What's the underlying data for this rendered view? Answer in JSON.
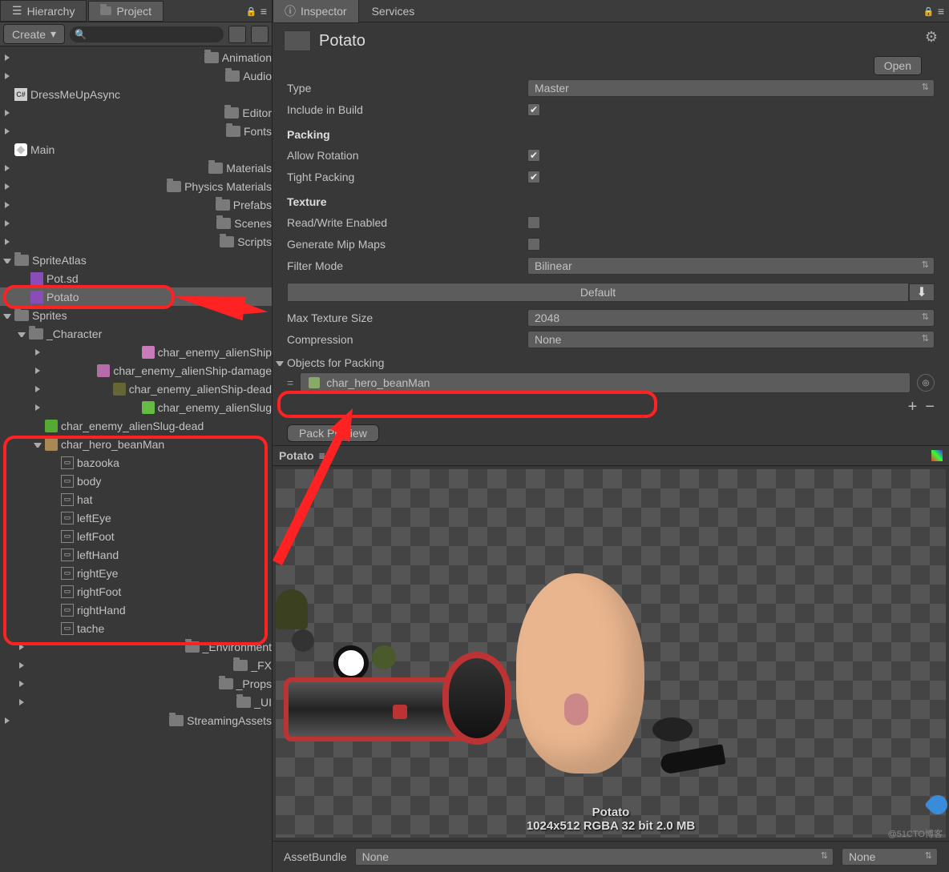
{
  "left": {
    "tabs": {
      "hierarchy": "Hierarchy",
      "project": "Project"
    },
    "create": "Create",
    "tree": {
      "animation": "Animation",
      "audio": "Audio",
      "dress": "DressMeUpAsync",
      "editor": "Editor",
      "fonts": "Fonts",
      "main": "Main",
      "materials": "Materials",
      "physmat": "Physics Materials",
      "prefabs": "Prefabs",
      "scenes": "Scenes",
      "scripts": "Scripts",
      "spriteatlas": "SpriteAtlas",
      "potsd": "Pot.sd",
      "potato": "Potato",
      "sprites": "Sprites",
      "character": "_Character",
      "alienship": "char_enemy_alienShip",
      "alienshipd": "char_enemy_alienShip-damage",
      "alienshipdead": "char_enemy_alienShip-dead",
      "alienslug": "char_enemy_alienSlug",
      "alienslugdead": "char_enemy_alienSlug-dead",
      "beanman": "char_hero_beanMan",
      "bazooka": "bazooka",
      "body": "body",
      "hat": "hat",
      "lefteye": "leftEye",
      "leftfoot": "leftFoot",
      "lefthand": "leftHand",
      "righteye": "rightEye",
      "rightfoot": "rightFoot",
      "righthand": "rightHand",
      "tache": "tache",
      "env": "_Environment",
      "fx": "_FX",
      "props": "_Props",
      "ui": "_UI",
      "streaming": "StreamingAssets"
    }
  },
  "right": {
    "tabs": {
      "inspector": "Inspector",
      "services": "Services"
    },
    "title": "Potato",
    "open": "Open",
    "type": "Type",
    "type_v": "Master",
    "include": "Include in Build",
    "packing": "Packing",
    "allowrot": "Allow Rotation",
    "tight": "Tight Packing",
    "texture": "Texture",
    "readwrite": "Read/Write Enabled",
    "mipmaps": "Generate Mip Maps",
    "filter": "Filter Mode",
    "filter_v": "Bilinear",
    "default": "Default",
    "maxsize": "Max Texture Size",
    "maxsize_v": "2048",
    "compression": "Compression",
    "compression_v": "None",
    "objects": "Objects for Packing",
    "object_slot": "char_hero_beanMan",
    "pack": "Pack Preview",
    "preview_title": "Potato",
    "preview_name": "Potato",
    "preview_info": "1024x512 RGBA 32 bit   2.0 MB",
    "assetbundle": "AssetBundle",
    "bundle_none": "None",
    "bundle_none2": "None"
  },
  "watermark": "@51CTO博客"
}
